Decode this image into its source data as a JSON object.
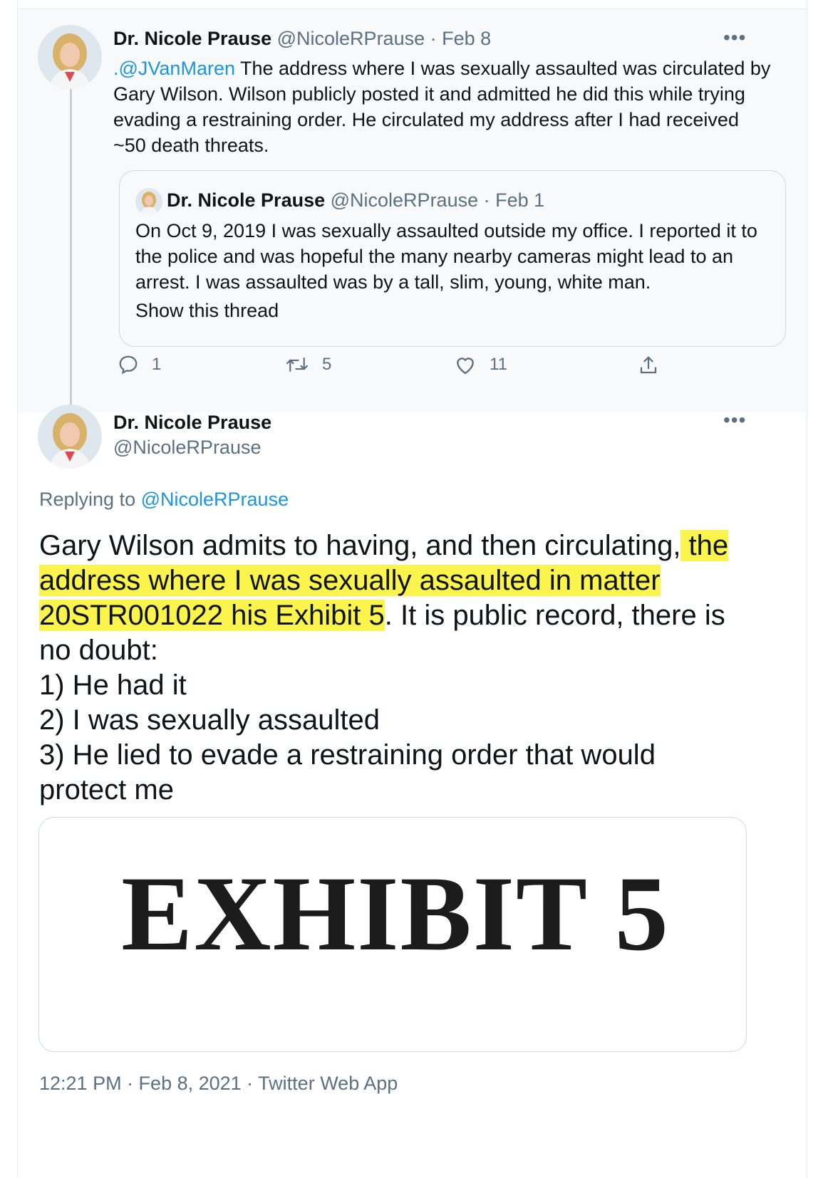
{
  "parent_tweet": {
    "author_name": "Dr. Nicole Prause",
    "author_handle": "@NicoleRPrause",
    "date": "Feb 8",
    "mention": ".@JVanMaren",
    "text_lines": [
      " The address where I was sexually assaulted was circulated by",
      "Gary Wilson. Wilson publicly posted it and admitted he did this while trying",
      "evading a restraining order. He circulated my address after I had received",
      "~50 death threats."
    ],
    "more_label": "•••",
    "quoted_tweet": {
      "author_name": "Dr. Nicole Prause",
      "author_handle": "@NicoleRPrause",
      "date": "Feb 1",
      "text_lines": [
        "On Oct 9, 2019 I was sexually assaulted outside my office. I reported it to",
        "the police and was hopeful the many nearby cameras might lead to an",
        "arrest. I was assaulted was by a tall, slim, young, white man."
      ],
      "show_thread_label": "Show this thread"
    },
    "actions": {
      "reply_count": "1",
      "retweet_count": "5",
      "like_count": "11"
    }
  },
  "main_tweet": {
    "author_name": "Dr. Nicole Prause",
    "author_handle": "@NicoleRPrause",
    "more_label": "•••",
    "replying_to_label": "Replying to",
    "replying_to_handle": "@NicoleRPrause",
    "text": {
      "l1_plain": "Gary Wilson admits to having, and then circulating,",
      "l1_hl": " the",
      "l2_hl": "address where I was sexually assaulted in matter",
      "l3_hl": "20STR001022 his Exhibit 5",
      "l3_plain": ". It is public record, there is",
      "l4": "no doubt:",
      "l5": "1) He had it",
      "l6": "2) I was sexually assaulted",
      "l7": "3) He lied to evade a restraining order that would",
      "l8": "protect me"
    },
    "media_text": "EXHIBIT 5",
    "timestamp": "12:21 PM · Feb 8, 2021 · Twitter Web App"
  },
  "colors": {
    "link": "#1b95e0",
    "muted": "#5b7083",
    "highlight": "#fbf44c",
    "parent_bg": "#f7f9fa"
  }
}
